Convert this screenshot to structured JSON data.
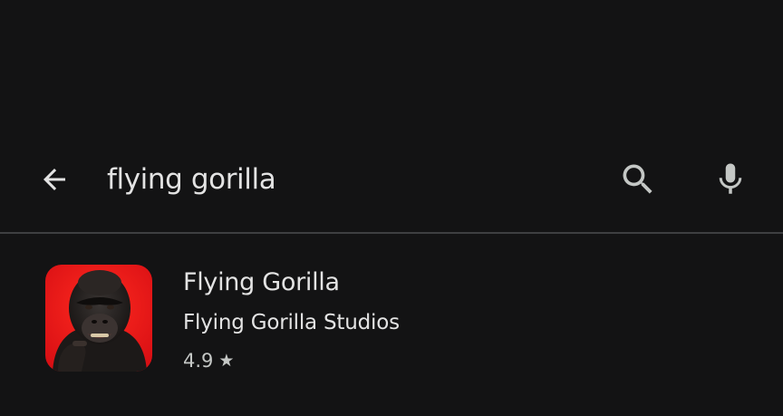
{
  "search": {
    "query": "flying gorilla",
    "back_icon": "arrow-back-icon",
    "search_icon": "search-icon",
    "mic_icon": "microphone-icon"
  },
  "results": [
    {
      "name": "Flying Gorilla",
      "developer": "Flying Gorilla Studios",
      "rating": "4.9",
      "rating_icon": "star-icon"
    }
  ],
  "colors": {
    "background": "#131314",
    "text": "#e3e3e3",
    "secondary_text": "#c4c7c5",
    "divider": "#3e3f41",
    "icon_red": "#e8141b"
  }
}
